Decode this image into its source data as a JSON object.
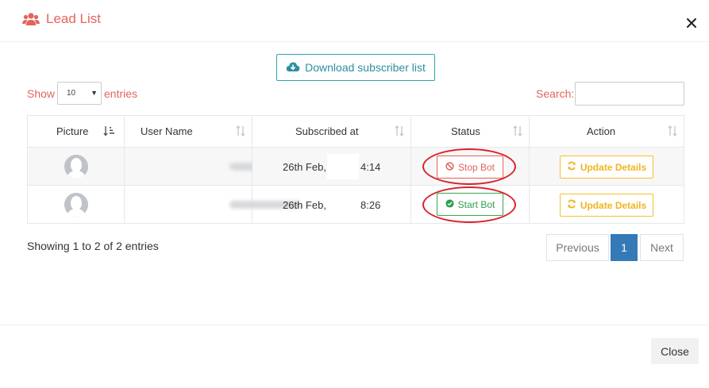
{
  "modal": {
    "title": "Lead List",
    "title_icon": "users-icon",
    "close_icon": "close-icon"
  },
  "download_button": {
    "label": "Download subscriber list",
    "icon": "cloud-download-icon"
  },
  "length_control": {
    "show_label": "Show",
    "selected": "10",
    "entries_label": "entries"
  },
  "search": {
    "label": "Search:",
    "value": ""
  },
  "table": {
    "columns": [
      "Picture",
      "User Name",
      "Subscribed at",
      "Status",
      "Action"
    ],
    "rows": [
      {
        "picture": "avatar-placeholder",
        "user_name": "",
        "date_prefix": "26th Feb,",
        "date_suffix": "4:14",
        "status_button": "Stop Bot",
        "status_icon": "ban-icon",
        "action": "Update Details",
        "action_icon": "refresh-icon"
      },
      {
        "picture": "avatar-placeholder",
        "user_name": "",
        "date_prefix": "26th Feb,",
        "date_suffix": "8:26",
        "status_button": "Start Bot",
        "status_icon": "check-circle-icon",
        "action": "Update Details",
        "action_icon": "refresh-icon"
      }
    ]
  },
  "info": "Showing 1 to 2 of 2 entries",
  "pagination": {
    "previous": "Previous",
    "current": "1",
    "next": "Next"
  },
  "footer": {
    "close_label": "Close"
  },
  "colors": {
    "accent_red": "#e3635d",
    "teal": "#2fa4b1",
    "green": "#35a853",
    "yellow": "#f5c02b",
    "primary_blue": "#337ab7",
    "annotation_red": "#d8222a"
  }
}
